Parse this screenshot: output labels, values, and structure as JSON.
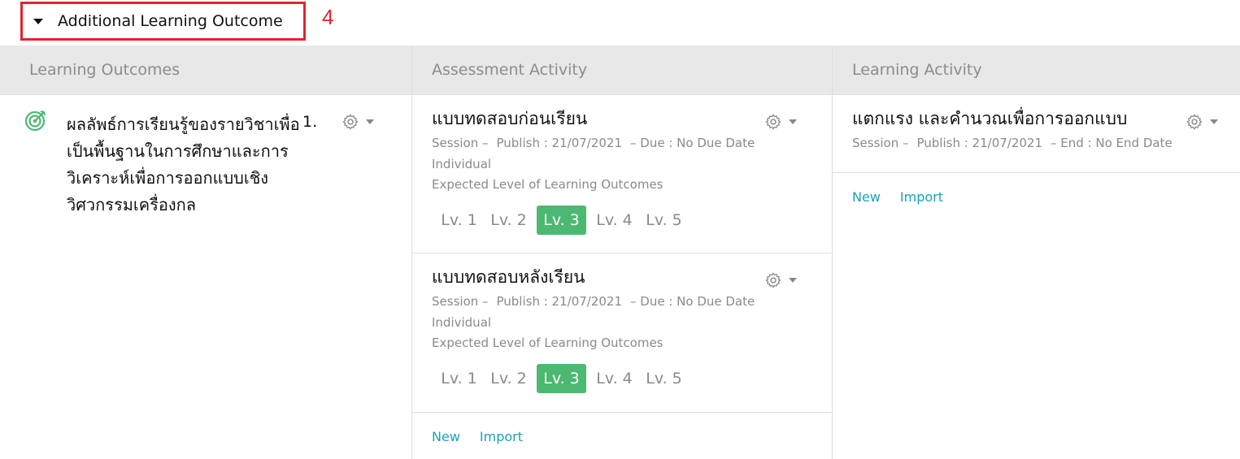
{
  "section": {
    "title": "Additional Learning Outcome",
    "annotation": "4"
  },
  "columns": {
    "learning_outcomes": {
      "header": "Learning Outcomes",
      "item": {
        "text": "ผลลัพธ์การเรียนรู้ของรายวิชาเพื่อเป็นพื้นฐานในการศึกษาและการวิเคราะห์เพื่อการออกแบบเชิงวิศวกรรมเครื่องกล",
        "number": "1."
      }
    },
    "assessment_activity": {
      "header": "Assessment Activity",
      "cards": [
        {
          "title": "แบบทดสอบก่อนเรียน",
          "session": "Session –",
          "publish": "Publish : 21/07/2021",
          "due": "– Due : No Due Date",
          "type": "Individual",
          "expected": "Expected Level of Learning Outcomes",
          "levels": [
            "Lv. 1",
            "Lv. 2",
            "Lv. 3",
            "Lv. 4",
            "Lv. 5"
          ],
          "active_level": 3
        },
        {
          "title": "แบบทดสอบหลังเรียน",
          "session": "Session –",
          "publish": "Publish : 21/07/2021",
          "due": "– Due : No Due Date",
          "type": "Individual",
          "expected": "Expected Level of Learning Outcomes",
          "levels": [
            "Lv. 1",
            "Lv. 2",
            "Lv. 3",
            "Lv. 4",
            "Lv. 5"
          ],
          "active_level": 3
        }
      ],
      "actions": {
        "new": "New",
        "import": "Import"
      }
    },
    "learning_activity": {
      "header": "Learning Activity",
      "cards": [
        {
          "title": "แตกแรง และคำนวณเพื่อการออกแบบ",
          "session": "Session –",
          "publish": "Publish : 21/07/2021",
          "end": "– End : No End Date"
        }
      ],
      "actions": {
        "new": "New",
        "import": "Import"
      }
    }
  },
  "colors": {
    "accent_green": "#4cb872",
    "link": "#1aa3b5",
    "annotation_red": "#e3242b",
    "header_bg": "#e8e8e8"
  },
  "icons": {
    "expand": "caret-down-icon",
    "outcome": "target-icon",
    "settings": "gear-icon"
  }
}
